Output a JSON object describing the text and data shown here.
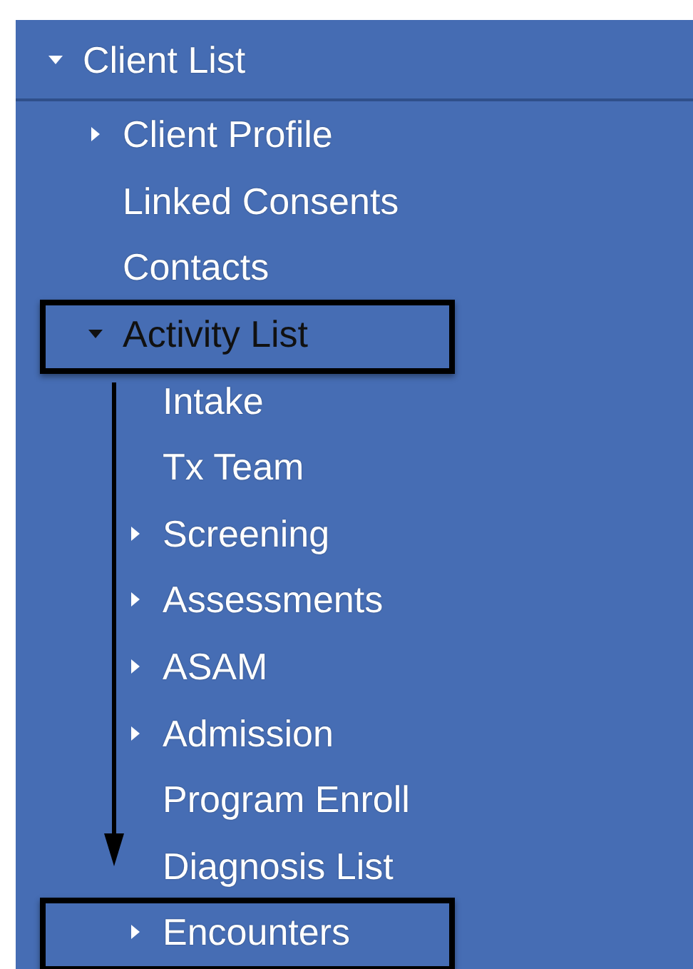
{
  "tree": {
    "label": "Client List",
    "kind": "branch",
    "expanded": true,
    "selected": false,
    "children": [
      {
        "label": "Client Profile",
        "kind": "branch",
        "expanded": false,
        "selected": false,
        "highlighted": false
      },
      {
        "label": "Linked Consents",
        "kind": "leaf",
        "selected": false,
        "highlighted": false
      },
      {
        "label": "Contacts",
        "kind": "leaf",
        "selected": false,
        "highlighted": false
      },
      {
        "label": "Activity List",
        "kind": "branch",
        "expanded": true,
        "selected": true,
        "highlighted": true,
        "children": [
          {
            "label": "Intake",
            "kind": "leaf",
            "selected": false,
            "highlighted": false
          },
          {
            "label": "Tx Team",
            "kind": "leaf",
            "selected": false,
            "highlighted": false
          },
          {
            "label": "Screening",
            "kind": "branch",
            "expanded": false,
            "selected": false,
            "highlighted": false
          },
          {
            "label": "Assessments",
            "kind": "branch",
            "expanded": false,
            "selected": false,
            "highlighted": false
          },
          {
            "label": "ASAM",
            "kind": "branch",
            "expanded": false,
            "selected": false,
            "highlighted": false
          },
          {
            "label": "Admission",
            "kind": "branch",
            "expanded": false,
            "selected": false,
            "highlighted": false
          },
          {
            "label": "Program Enroll",
            "kind": "leaf",
            "selected": false,
            "highlighted": false
          },
          {
            "label": "Diagnosis List",
            "kind": "leaf",
            "selected": false,
            "highlighted": false
          },
          {
            "label": "Encounters",
            "kind": "branch",
            "expanded": false,
            "selected": false,
            "highlighted": true
          }
        ]
      }
    ]
  }
}
